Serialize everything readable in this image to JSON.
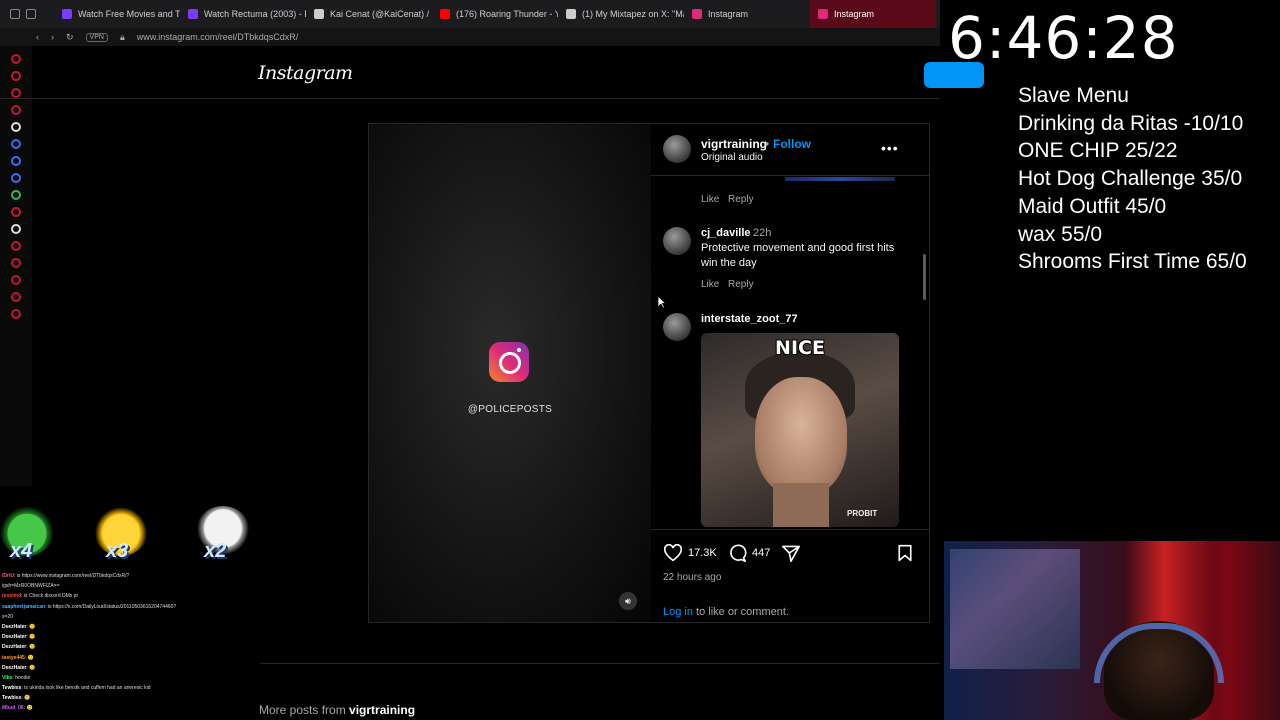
{
  "browser": {
    "tabs": [
      {
        "title": "Watch Free Movies and T",
        "color": "#7a3cff",
        "active": false
      },
      {
        "title": "Watch Rectuma (2003) - F",
        "color": "#7a3cff",
        "active": false
      },
      {
        "title": "Kai Cenat (@KaiCenat) / X",
        "color": "#cccccc",
        "active": false
      },
      {
        "title": "(176) Roaring Thunder - Y",
        "color": "#ff0000",
        "active": false
      },
      {
        "title": "(1) My Mixtapez on X: \"Ma",
        "color": "#cccccc",
        "active": false
      },
      {
        "title": "Instagram",
        "color": "#dd2a7b",
        "active": false
      },
      {
        "title": "Instagram",
        "color": "#dd2a7b",
        "active": true
      }
    ],
    "vpn_label": "VPN",
    "url": "www.instagram.com/reel/DTbkdqsCdxR/"
  },
  "instagram": {
    "logo": "Instagram",
    "video_tag": "@POLICEPOSTS",
    "post_header": {
      "username": "vigrtraining",
      "dot": "•",
      "follow_label": "Follow",
      "audio": "Original audio",
      "more": "•••"
    },
    "comments": [
      {
        "like_label": "Like",
        "reply_label": "Reply"
      },
      {
        "username": "cj_daville",
        "time": "22h",
        "text": "Protective movement and good first hits win the day",
        "like_label": "Like",
        "reply_label": "Reply"
      },
      {
        "username": "interstate_zoot_77",
        "gif_caption": "NICE",
        "gif_watermark": "PROBIT"
      }
    ],
    "likes": "17.3K",
    "comments_count": "447",
    "time_ago": "22 hours ago",
    "login_link": "Log in",
    "login_rest": " to like or comment.",
    "more_posts_prefix": "More posts from ",
    "more_posts_user": "vigrtraining"
  },
  "overlay": {
    "clock": "6:46:28",
    "menu": [
      "Slave Menu",
      "Drinking da Ritas -10/10",
      "ONE CHIP 25/22",
      "Hot Dog Challenge  35/0",
      "Maid Outfit 45/0",
      "wax 55/0",
      "Shrooms First Time 65/0"
    ]
  },
  "emotes": [
    {
      "name": "frog-emote",
      "count": "x4"
    },
    {
      "name": "duck-emote",
      "count": "x3"
    },
    {
      "name": "skull-emote",
      "count": "x2"
    }
  ],
  "chat": [
    {
      "user": "iDriU",
      "msg": ": is https://www.instagram.com/reel/DTbkdqsCdxR/?",
      "color": "#ff5a9a"
    },
    {
      "user": "",
      "msg": "igsh=MzR0OBNWFIZA==",
      "color": "#ffffff"
    },
    {
      "user": "teoslmd",
      "msg": ": is Check discord DMs pr",
      "color": "#ff4a4a"
    },
    {
      "user": "saapheetjamaican",
      "msg": ": is https://x.com/DailyLoud/status/2011050361620474460?",
      "color": "#4ab0ff"
    },
    {
      "user": "",
      "msg": "s=20",
      "color": "#ffffff"
    },
    {
      "user": "DeezHater",
      "msg": ": 🙂",
      "color": "#ffffff"
    },
    {
      "user": "DeezHater",
      "msg": ": 🙂",
      "color": "#ffffff"
    },
    {
      "user": "DezzHater",
      "msg": ": 🙂",
      "color": "#ffffff"
    },
    {
      "user": "tastye445",
      "msg": ": 🙂",
      "color": "#ff9a3a"
    },
    {
      "user": "DeezHater",
      "msg": ": 🙂",
      "color": "#ffffff"
    },
    {
      "user": "Vibs",
      "msg": ": hoodie",
      "color": "#3aff6a"
    },
    {
      "user": "Tewbiss",
      "msg": ": ts ukinda look like benstk and cuffem had an anerexic kid",
      "color": "#ffffff"
    },
    {
      "user": "Tewbiss",
      "msg": ": 🙂",
      "color": "#ffffff"
    },
    {
      "user": "Mbud_06",
      "msg": ": 🙂",
      "color": "#d45aff"
    }
  ],
  "colors": {
    "accent": "#0095f6",
    "active_tab": "#5b0a1a"
  }
}
